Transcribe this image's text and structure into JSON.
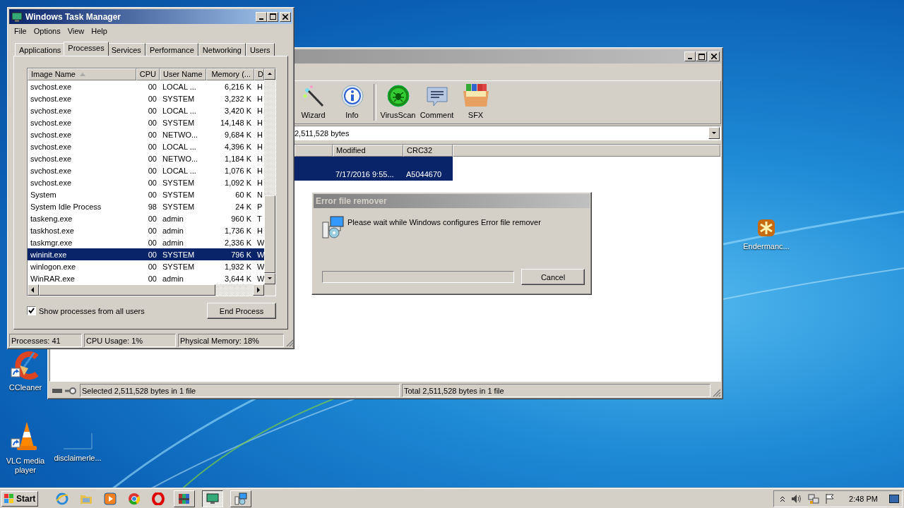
{
  "task_manager": {
    "title": "Windows Task Manager",
    "active": true,
    "menu": [
      "File",
      "Options",
      "View",
      "Help"
    ],
    "tabs": [
      {
        "label": "Applications",
        "selected": false
      },
      {
        "label": "Processes",
        "selected": true
      },
      {
        "label": "Services",
        "selected": false
      },
      {
        "label": "Performance",
        "selected": false
      },
      {
        "label": "Networking",
        "selected": false
      },
      {
        "label": "Users",
        "selected": false
      }
    ],
    "columns": [
      "Image Name",
      "CPU",
      "User Name",
      "Memory (...",
      "D"
    ],
    "rows": [
      {
        "cells": [
          "svchost.exe",
          "00",
          "LOCAL ...",
          "6,216 K",
          "H"
        ],
        "selected": false
      },
      {
        "cells": [
          "svchost.exe",
          "00",
          "SYSTEM",
          "3,232 K",
          "H"
        ],
        "selected": false
      },
      {
        "cells": [
          "svchost.exe",
          "00",
          "LOCAL ...",
          "3,420 K",
          "H"
        ],
        "selected": false
      },
      {
        "cells": [
          "svchost.exe",
          "00",
          "SYSTEM",
          "14,148 K",
          "H"
        ],
        "selected": false
      },
      {
        "cells": [
          "svchost.exe",
          "00",
          "NETWO...",
          "9,684 K",
          "H"
        ],
        "selected": false
      },
      {
        "cells": [
          "svchost.exe",
          "00",
          "LOCAL ...",
          "4,396 K",
          "H"
        ],
        "selected": false
      },
      {
        "cells": [
          "svchost.exe",
          "00",
          "NETWO...",
          "1,184 K",
          "H"
        ],
        "selected": false
      },
      {
        "cells": [
          "svchost.exe",
          "00",
          "LOCAL ...",
          "1,076 K",
          "H"
        ],
        "selected": false
      },
      {
        "cells": [
          "svchost.exe",
          "00",
          "SYSTEM",
          "1,092 K",
          "H"
        ],
        "selected": false
      },
      {
        "cells": [
          "System",
          "00",
          "SYSTEM",
          "60 K",
          "N"
        ],
        "selected": false
      },
      {
        "cells": [
          "System Idle Process",
          "98",
          "SYSTEM",
          "24 K",
          "P"
        ],
        "selected": false
      },
      {
        "cells": [
          "taskeng.exe",
          "00",
          "admin",
          "960 K",
          "T"
        ],
        "selected": false
      },
      {
        "cells": [
          "taskhost.exe",
          "00",
          "admin",
          "1,736 K",
          "H"
        ],
        "selected": false
      },
      {
        "cells": [
          "taskmgr.exe",
          "00",
          "admin",
          "2,336 K",
          "W"
        ],
        "selected": false
      },
      {
        "cells": [
          "wininit.exe",
          "00",
          "SYSTEM",
          "796 K",
          "W"
        ],
        "selected": true
      },
      {
        "cells": [
          "winlogon.exe",
          "00",
          "SYSTEM",
          "1,932 K",
          "W"
        ],
        "selected": false
      },
      {
        "cells": [
          "WinRAR.exe",
          "00",
          "admin",
          "3,644 K",
          "W"
        ],
        "selected": false
      }
    ],
    "show_all_users": {
      "label": "Show processes from all users",
      "checked": true
    },
    "end_process": "End Process",
    "status_bar": [
      "Processes: 41",
      "CPU Usage: 1%",
      "Physical Memory: 18%"
    ]
  },
  "winrar": {
    "active": false,
    "toolbar": [
      {
        "kind": "wizard",
        "label": "Wizard"
      },
      {
        "kind": "info",
        "label": "Info"
      },
      {
        "kind": "separator"
      },
      {
        "kind": "virusscan",
        "label": "VirusScan"
      },
      {
        "kind": "comment",
        "label": "Comment"
      },
      {
        "kind": "sfx",
        "label": "SFX"
      }
    ],
    "path": "2,511,528 bytes",
    "columns": [
      "Modified",
      "CRC32"
    ],
    "rows": [
      {
        "cells": [
          "7/17/2016 9:55...",
          "A5044670"
        ],
        "selected": true
      }
    ],
    "status_bar": [
      "Selected 2,511,528 bytes in 1 file",
      "Total 2,511,528 bytes in 1 file"
    ]
  },
  "dialog": {
    "title": "Error file remover",
    "active": false,
    "message": "Please wait while Windows configures Error file remover",
    "progress": {
      "level": 0
    },
    "cancel": "Cancel"
  },
  "desktop_icons": [
    {
      "kind": "star",
      "label": "Endermanc..."
    },
    {
      "kind": "ccleaner",
      "label": "CCleaner"
    },
    {
      "kind": "vlc",
      "label": "VLC media player"
    },
    {
      "kind": "blank",
      "label": "disclaimerle..."
    }
  ],
  "taskbar": {
    "start": "Start",
    "quick_launch": [
      {
        "kind": "ie"
      },
      {
        "kind": "folder"
      },
      {
        "kind": "media"
      },
      {
        "kind": "chrome"
      },
      {
        "kind": "opera"
      }
    ],
    "windows": [
      {
        "kind": "winrar",
        "selected": false
      },
      {
        "kind": "taskmgr",
        "selected": true
      },
      {
        "kind": "setup",
        "selected": false
      }
    ],
    "clock": "2:48 PM"
  }
}
